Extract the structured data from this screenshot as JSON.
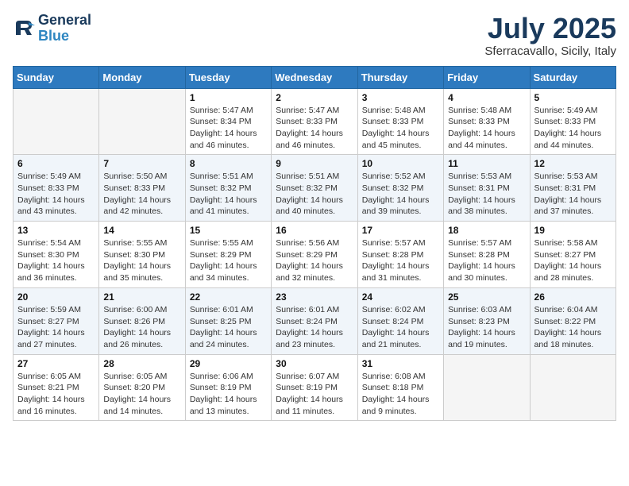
{
  "header": {
    "logo_line1": "General",
    "logo_line2": "Blue",
    "month_title": "July 2025",
    "location": "Sferracavallo, Sicily, Italy"
  },
  "weekdays": [
    "Sunday",
    "Monday",
    "Tuesday",
    "Wednesday",
    "Thursday",
    "Friday",
    "Saturday"
  ],
  "weeks": [
    [
      {
        "day": "",
        "info": ""
      },
      {
        "day": "",
        "info": ""
      },
      {
        "day": "1",
        "sunrise": "5:47 AM",
        "sunset": "8:34 PM",
        "daylight": "14 hours and 46 minutes."
      },
      {
        "day": "2",
        "sunrise": "5:47 AM",
        "sunset": "8:33 PM",
        "daylight": "14 hours and 46 minutes."
      },
      {
        "day": "3",
        "sunrise": "5:48 AM",
        "sunset": "8:33 PM",
        "daylight": "14 hours and 45 minutes."
      },
      {
        "day": "4",
        "sunrise": "5:48 AM",
        "sunset": "8:33 PM",
        "daylight": "14 hours and 44 minutes."
      },
      {
        "day": "5",
        "sunrise": "5:49 AM",
        "sunset": "8:33 PM",
        "daylight": "14 hours and 44 minutes."
      }
    ],
    [
      {
        "day": "6",
        "sunrise": "5:49 AM",
        "sunset": "8:33 PM",
        "daylight": "14 hours and 43 minutes."
      },
      {
        "day": "7",
        "sunrise": "5:50 AM",
        "sunset": "8:33 PM",
        "daylight": "14 hours and 42 minutes."
      },
      {
        "day": "8",
        "sunrise": "5:51 AM",
        "sunset": "8:32 PM",
        "daylight": "14 hours and 41 minutes."
      },
      {
        "day": "9",
        "sunrise": "5:51 AM",
        "sunset": "8:32 PM",
        "daylight": "14 hours and 40 minutes."
      },
      {
        "day": "10",
        "sunrise": "5:52 AM",
        "sunset": "8:32 PM",
        "daylight": "14 hours and 39 minutes."
      },
      {
        "day": "11",
        "sunrise": "5:53 AM",
        "sunset": "8:31 PM",
        "daylight": "14 hours and 38 minutes."
      },
      {
        "day": "12",
        "sunrise": "5:53 AM",
        "sunset": "8:31 PM",
        "daylight": "14 hours and 37 minutes."
      }
    ],
    [
      {
        "day": "13",
        "sunrise": "5:54 AM",
        "sunset": "8:30 PM",
        "daylight": "14 hours and 36 minutes."
      },
      {
        "day": "14",
        "sunrise": "5:55 AM",
        "sunset": "8:30 PM",
        "daylight": "14 hours and 35 minutes."
      },
      {
        "day": "15",
        "sunrise": "5:55 AM",
        "sunset": "8:29 PM",
        "daylight": "14 hours and 34 minutes."
      },
      {
        "day": "16",
        "sunrise": "5:56 AM",
        "sunset": "8:29 PM",
        "daylight": "14 hours and 32 minutes."
      },
      {
        "day": "17",
        "sunrise": "5:57 AM",
        "sunset": "8:28 PM",
        "daylight": "14 hours and 31 minutes."
      },
      {
        "day": "18",
        "sunrise": "5:57 AM",
        "sunset": "8:28 PM",
        "daylight": "14 hours and 30 minutes."
      },
      {
        "day": "19",
        "sunrise": "5:58 AM",
        "sunset": "8:27 PM",
        "daylight": "14 hours and 28 minutes."
      }
    ],
    [
      {
        "day": "20",
        "sunrise": "5:59 AM",
        "sunset": "8:27 PM",
        "daylight": "14 hours and 27 minutes."
      },
      {
        "day": "21",
        "sunrise": "6:00 AM",
        "sunset": "8:26 PM",
        "daylight": "14 hours and 26 minutes."
      },
      {
        "day": "22",
        "sunrise": "6:01 AM",
        "sunset": "8:25 PM",
        "daylight": "14 hours and 24 minutes."
      },
      {
        "day": "23",
        "sunrise": "6:01 AM",
        "sunset": "8:24 PM",
        "daylight": "14 hours and 23 minutes."
      },
      {
        "day": "24",
        "sunrise": "6:02 AM",
        "sunset": "8:24 PM",
        "daylight": "14 hours and 21 minutes."
      },
      {
        "day": "25",
        "sunrise": "6:03 AM",
        "sunset": "8:23 PM",
        "daylight": "14 hours and 19 minutes."
      },
      {
        "day": "26",
        "sunrise": "6:04 AM",
        "sunset": "8:22 PM",
        "daylight": "14 hours and 18 minutes."
      }
    ],
    [
      {
        "day": "27",
        "sunrise": "6:05 AM",
        "sunset": "8:21 PM",
        "daylight": "14 hours and 16 minutes."
      },
      {
        "day": "28",
        "sunrise": "6:05 AM",
        "sunset": "8:20 PM",
        "daylight": "14 hours and 14 minutes."
      },
      {
        "day": "29",
        "sunrise": "6:06 AM",
        "sunset": "8:19 PM",
        "daylight": "14 hours and 13 minutes."
      },
      {
        "day": "30",
        "sunrise": "6:07 AM",
        "sunset": "8:19 PM",
        "daylight": "14 hours and 11 minutes."
      },
      {
        "day": "31",
        "sunrise": "6:08 AM",
        "sunset": "8:18 PM",
        "daylight": "14 hours and 9 minutes."
      },
      {
        "day": "",
        "info": ""
      },
      {
        "day": "",
        "info": ""
      }
    ]
  ]
}
